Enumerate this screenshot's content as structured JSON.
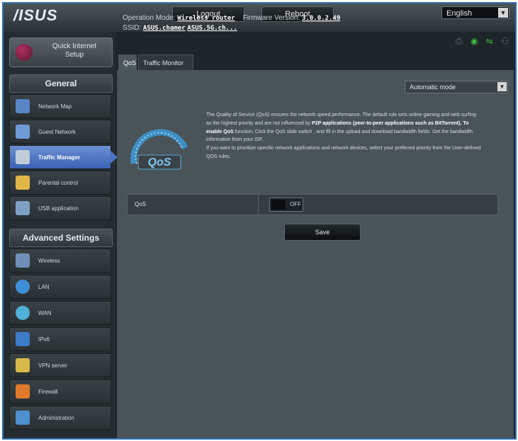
{
  "header": {
    "brand": "/ISUS",
    "logout_label": "Logout",
    "reboot_label": "Reboot",
    "language": "English",
    "operation_mode_label": "Operation Mode:",
    "operation_mode_value": "Wireless router",
    "firmware_label": "Firmware Version:",
    "firmware_value": "3.0.0.2.49",
    "ssid_label": "SSID:",
    "ssid_1": "ASUS.chamer",
    "ssid_2": "ASUS.5G.ch..."
  },
  "sidebar": {
    "quick_setup_label": "Quick Internet Setup",
    "general_header": "General",
    "general_items": [
      {
        "label": "Network Map",
        "icon": "network-map-icon",
        "color": "#5a86c8"
      },
      {
        "label": "Guest Network",
        "icon": "guest-network-icon",
        "color": "#6f9ad8"
      },
      {
        "label": "Traffic Manager",
        "icon": "traffic-manager-icon",
        "color": "#c0ccd8",
        "active": true
      },
      {
        "label": "Parental control",
        "icon": "parental-control-icon",
        "color": "#e0b648"
      },
      {
        "label": "USB application",
        "icon": "usb-application-icon",
        "color": "#7ea0c4"
      }
    ],
    "advanced_header": "Advanced Settings",
    "advanced_items": [
      {
        "label": "Wireless",
        "icon": "wireless-icon",
        "color": "#6f8fb8"
      },
      {
        "label": "LAN",
        "icon": "lan-icon",
        "color": "#3f8fd8"
      },
      {
        "label": "WAN",
        "icon": "wan-icon",
        "color": "#4fb0d8"
      },
      {
        "label": "IPv6",
        "icon": "ipv6-icon",
        "color": "#3d7ac8"
      },
      {
        "label": "VPN server",
        "icon": "vpn-server-icon",
        "color": "#d8b84a"
      },
      {
        "label": "Firewall",
        "icon": "firewall-icon",
        "color": "#e07a2a"
      },
      {
        "label": "Administration",
        "icon": "administration-icon",
        "color": "#4f8fd0"
      }
    ]
  },
  "tabs": [
    {
      "label": "QoS",
      "active": true
    },
    {
      "label": "Traffic Monitor",
      "active": false
    }
  ],
  "main": {
    "mode_select": "Automatic mode",
    "description_1": "The Quality of Service (QoS) ensures the network speed performance. The default rule sets online gaming and web surfing as the highest priority and are not influenced by",
    "description_highlight": "P2P applications (peer-to-peer applications such as BitTorrent). To enable QoS",
    "description_2": "function, Click the QoS slide switch , and fill in the upload and download bandwidth fields. Get the bandwidth information from your ISP.",
    "description_3": "If you want to prioritize specific network applications and network devices, select your preferred priority from the User-defined QOS rules.",
    "gauge_text": "QoS",
    "qos_label": "QoS",
    "qos_state": "OFF",
    "save_label": "Save"
  },
  "colors": {
    "accent_blue": "#3a63b5",
    "status_green": "#3fbf3f"
  }
}
